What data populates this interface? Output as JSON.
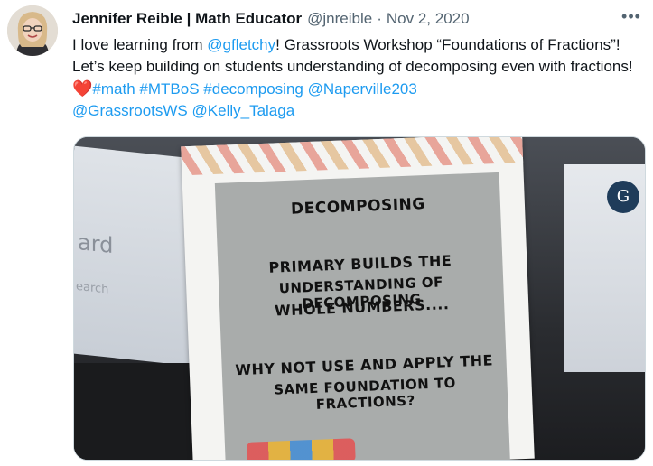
{
  "author": {
    "display_name": "Jennifer Reible | Math Educator",
    "handle": "@jnreible",
    "separator": "·",
    "date": "Nov 2, 2020"
  },
  "more_icon": "more-horizontal-icon",
  "tweet": {
    "t1": "I love learning from ",
    "m1": "@gfletchy",
    "t2": "! Grassroots Workshop “Foundations of Fractions”! Let’s keep building on students understanding of decomposing even with fractions! ",
    "heart": "❤️",
    "h1": "#math",
    "h2": "#MTBoS",
    "h3": "#decomposing",
    "m2": "@Naperville203",
    "m3": "@GrassrootsWS",
    "m4": "@Kelly_Talaga"
  },
  "media": {
    "card_title": "DECOMPOSING",
    "card_line1": "PRIMARY BUILDS THE",
    "card_line2": "UNDERSTANDING OF DECOMPOSING",
    "card_line3": "WHOLE NUMBERS....",
    "card_line4": "WHY NOT USE AND APPLY THE",
    "card_line5": "SAME FOUNDATION TO FRACTIONS?",
    "left_screen_text": "ard",
    "left_screen_subtext": "earch",
    "right_logo_text": "G"
  },
  "colors": {
    "link": "#1d9bf0",
    "heart": "#e0245e",
    "muted": "#536471"
  }
}
